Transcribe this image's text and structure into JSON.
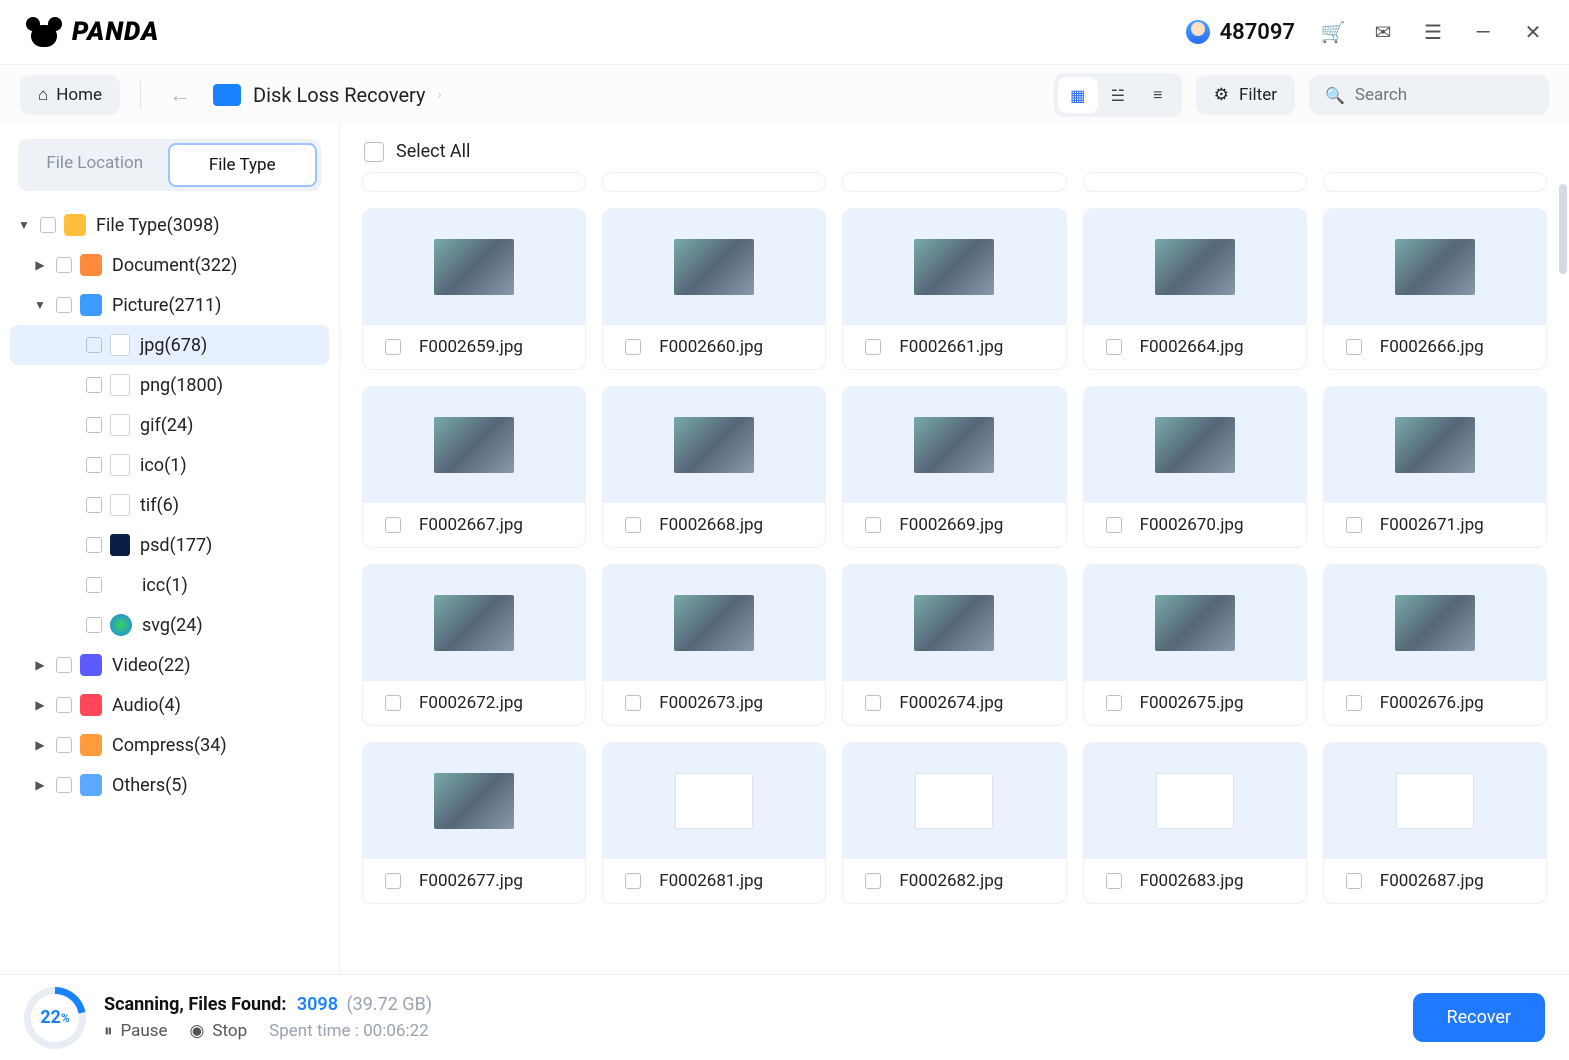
{
  "app": {
    "name": "PANDA",
    "user_points": "487097"
  },
  "toolbar": {
    "home_label": "Home",
    "breadcrumb": "Disk Loss Recovery",
    "filter_label": "Filter",
    "search_placeholder": "Search"
  },
  "sidebar": {
    "tabs": {
      "location": "File Location",
      "type": "File Type"
    },
    "root": {
      "label": "File Type(3098)"
    },
    "categories": [
      {
        "key": "document",
        "label": "Document(322)"
      },
      {
        "key": "picture",
        "label": "Picture(2711)"
      },
      {
        "key": "video",
        "label": "Video(22)"
      },
      {
        "key": "audio",
        "label": "Audio(4)"
      },
      {
        "key": "compress",
        "label": "Compress(34)"
      },
      {
        "key": "others",
        "label": "Others(5)"
      }
    ],
    "picture_children": [
      {
        "key": "jpg",
        "label": "jpg(678)"
      },
      {
        "key": "png",
        "label": "png(1800)"
      },
      {
        "key": "gif",
        "label": "gif(24)"
      },
      {
        "key": "ico",
        "label": "ico(1)"
      },
      {
        "key": "tif",
        "label": "tif(6)"
      },
      {
        "key": "psd",
        "label": "psd(177)"
      },
      {
        "key": "icc",
        "label": "icc(1)"
      },
      {
        "key": "svg",
        "label": "svg(24)"
      }
    ]
  },
  "main": {
    "select_all_label": "Select All",
    "files": [
      {
        "name": "F0002659.jpg",
        "kind": "img"
      },
      {
        "name": "F0002660.jpg",
        "kind": "img"
      },
      {
        "name": "F0002661.jpg",
        "kind": "img"
      },
      {
        "name": "F0002664.jpg",
        "kind": "img"
      },
      {
        "name": "F0002666.jpg",
        "kind": "img"
      },
      {
        "name": "F0002667.jpg",
        "kind": "img"
      },
      {
        "name": "F0002668.jpg",
        "kind": "img"
      },
      {
        "name": "F0002669.jpg",
        "kind": "img"
      },
      {
        "name": "F0002670.jpg",
        "kind": "img"
      },
      {
        "name": "F0002671.jpg",
        "kind": "img"
      },
      {
        "name": "F0002672.jpg",
        "kind": "img"
      },
      {
        "name": "F0002673.jpg",
        "kind": "img"
      },
      {
        "name": "F0002674.jpg",
        "kind": "img"
      },
      {
        "name": "F0002675.jpg",
        "kind": "img"
      },
      {
        "name": "F0002676.jpg",
        "kind": "img"
      },
      {
        "name": "F0002677.jpg",
        "kind": "img"
      },
      {
        "name": "F0002681.jpg",
        "kind": "doc"
      },
      {
        "name": "F0002682.jpg",
        "kind": "doc"
      },
      {
        "name": "F0002683.jpg",
        "kind": "doc"
      },
      {
        "name": "F0002687.jpg",
        "kind": "doc"
      }
    ]
  },
  "status": {
    "percent": "22",
    "percent_suffix": "%",
    "scanning_label": "Scanning, Files Found:",
    "count": "3098",
    "size": "(39.72 GB)",
    "pause_label": "Pause",
    "stop_label": "Stop",
    "spent_label": "Spent time : 00:06:22",
    "recover_label": "Recover"
  }
}
